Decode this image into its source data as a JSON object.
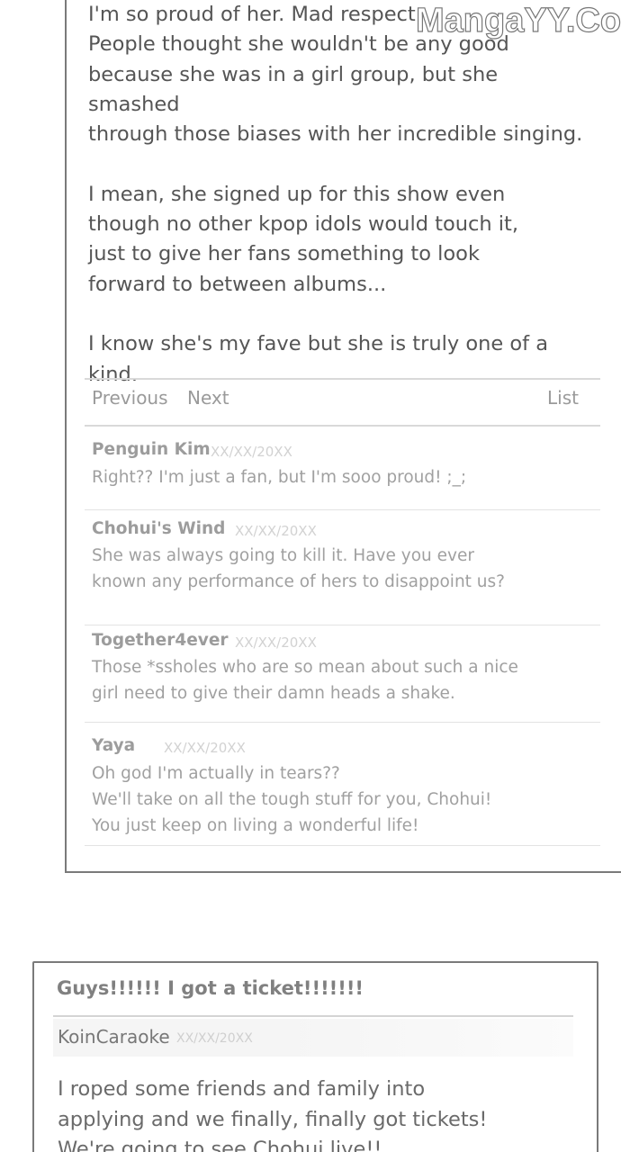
{
  "watermark": "MangaYY.Com",
  "post1": {
    "paragraphs": [
      "I'm so proud of her. Mad respect.\nPeople thought she wouldn't be any good\nbecause she was in a girl group, but she smashed\nthrough those biases with her incredible singing.",
      "I mean, she signed up for this show even\nthough no other kpop idols would touch it,\njust to give her fans something to look\nforward to between albums...",
      "I know she's my fave but she is truly one of a kind."
    ]
  },
  "nav": {
    "previous": "Previous",
    "next": "Next",
    "list": "List"
  },
  "comments": [
    {
      "author": "Penguin Kim",
      "date": "XX/XX/20XX",
      "text": "Right?? I'm just a fan, but I'm sooo proud! ;_;"
    },
    {
      "author": "Chohui's Wind",
      "date": "XX/XX/20XX",
      "text": "She was always going to kill it. Have you ever\nknown any performance of hers to disappoint us?"
    },
    {
      "author": "Together4ever",
      "date": "XX/XX/20XX",
      "text": "Those *ssholes who are so mean about such a nice\ngirl need to give their damn heads a shake."
    },
    {
      "author": "Yaya",
      "date": "XX/XX/20XX",
      "text": "Oh god I'm actually in tears??\nWe'll take on all the tough stuff for you, Chohui!\nYou just keep on living a wonderful life!"
    }
  ],
  "post2": {
    "title": "Guys!!!!!! I got a ticket!!!!!!!",
    "author": "KoinCaraoke",
    "date": "XX/XX/20XX",
    "body": "I roped some friends and family into\napplying and we finally, finally got tickets!\nWe're going to see Chohui live!!"
  }
}
